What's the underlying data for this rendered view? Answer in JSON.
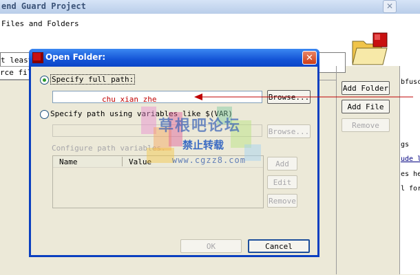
{
  "background_window": {
    "title": "end Guard Project",
    "header_text": "Files and Folders",
    "error_text": "t least one source must be specified",
    "tab_label": "rce file",
    "right_text": [
      "bfusc",
      "gs",
      "ude l",
      "es he",
      "l for"
    ],
    "buttons": {
      "add_folder": "Add Folder",
      "add_file": "Add File",
      "remove": "Remove"
    }
  },
  "dialog": {
    "title": "Open Folder:",
    "close_glyph": "✕",
    "option_full_path": "Specify full path:",
    "full_path_value": "",
    "annotation": "chu xian zhe",
    "option_variables": "Specify path using variables like $(VAR)",
    "variables_path_value": "",
    "browse_label": "Browse...",
    "configure_label": "Configure path variables.",
    "table_columns": [
      "Name",
      "Value"
    ],
    "buttons": {
      "add": "Add",
      "edit": "Edit",
      "remove": "Remove",
      "ok": "OK",
      "cancel": "Cancel"
    }
  },
  "watermark": {
    "title": "草根吧论坛",
    "subtitle": "禁止转载",
    "url": "www.cgzz8.com"
  },
  "colors": {
    "dialog_title": "#1454d6",
    "annotation": "#c00000"
  }
}
